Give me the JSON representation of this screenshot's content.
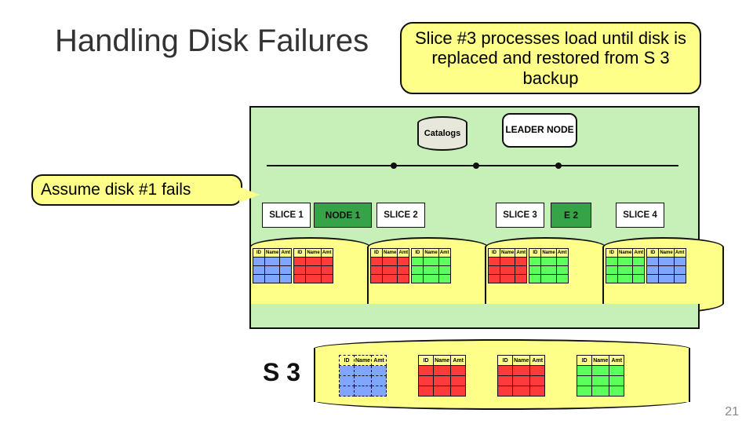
{
  "title": "Handling Disk Failures",
  "callout_top": "Slice #3 processes load until disk is replaced and restored from S 3 backup",
  "callout_left": "Assume disk #1 fails",
  "catalogs_label": "Catalogs",
  "leader_label": "LEADER NODE",
  "s3_label": "S 3",
  "page_number": "21",
  "table_headers": {
    "a": "ID",
    "b": "Name",
    "c": "Amt"
  },
  "slices": {
    "s1": "SLICE 1",
    "s2": "SLICE 2",
    "s3": "SLICE 3",
    "s4": "SLICE 4",
    "n1": "NODE 1",
    "n2_suffix": "E 2"
  },
  "chart_data": {
    "type": "table",
    "note": "Diagram of distributed compute nodes with two mini-tables (ID|Name|Amt) rendered inside each of 4 disk cylinders; S3 cylinder holds 4 backup tables. Disk 1 is the failed disk."
  }
}
